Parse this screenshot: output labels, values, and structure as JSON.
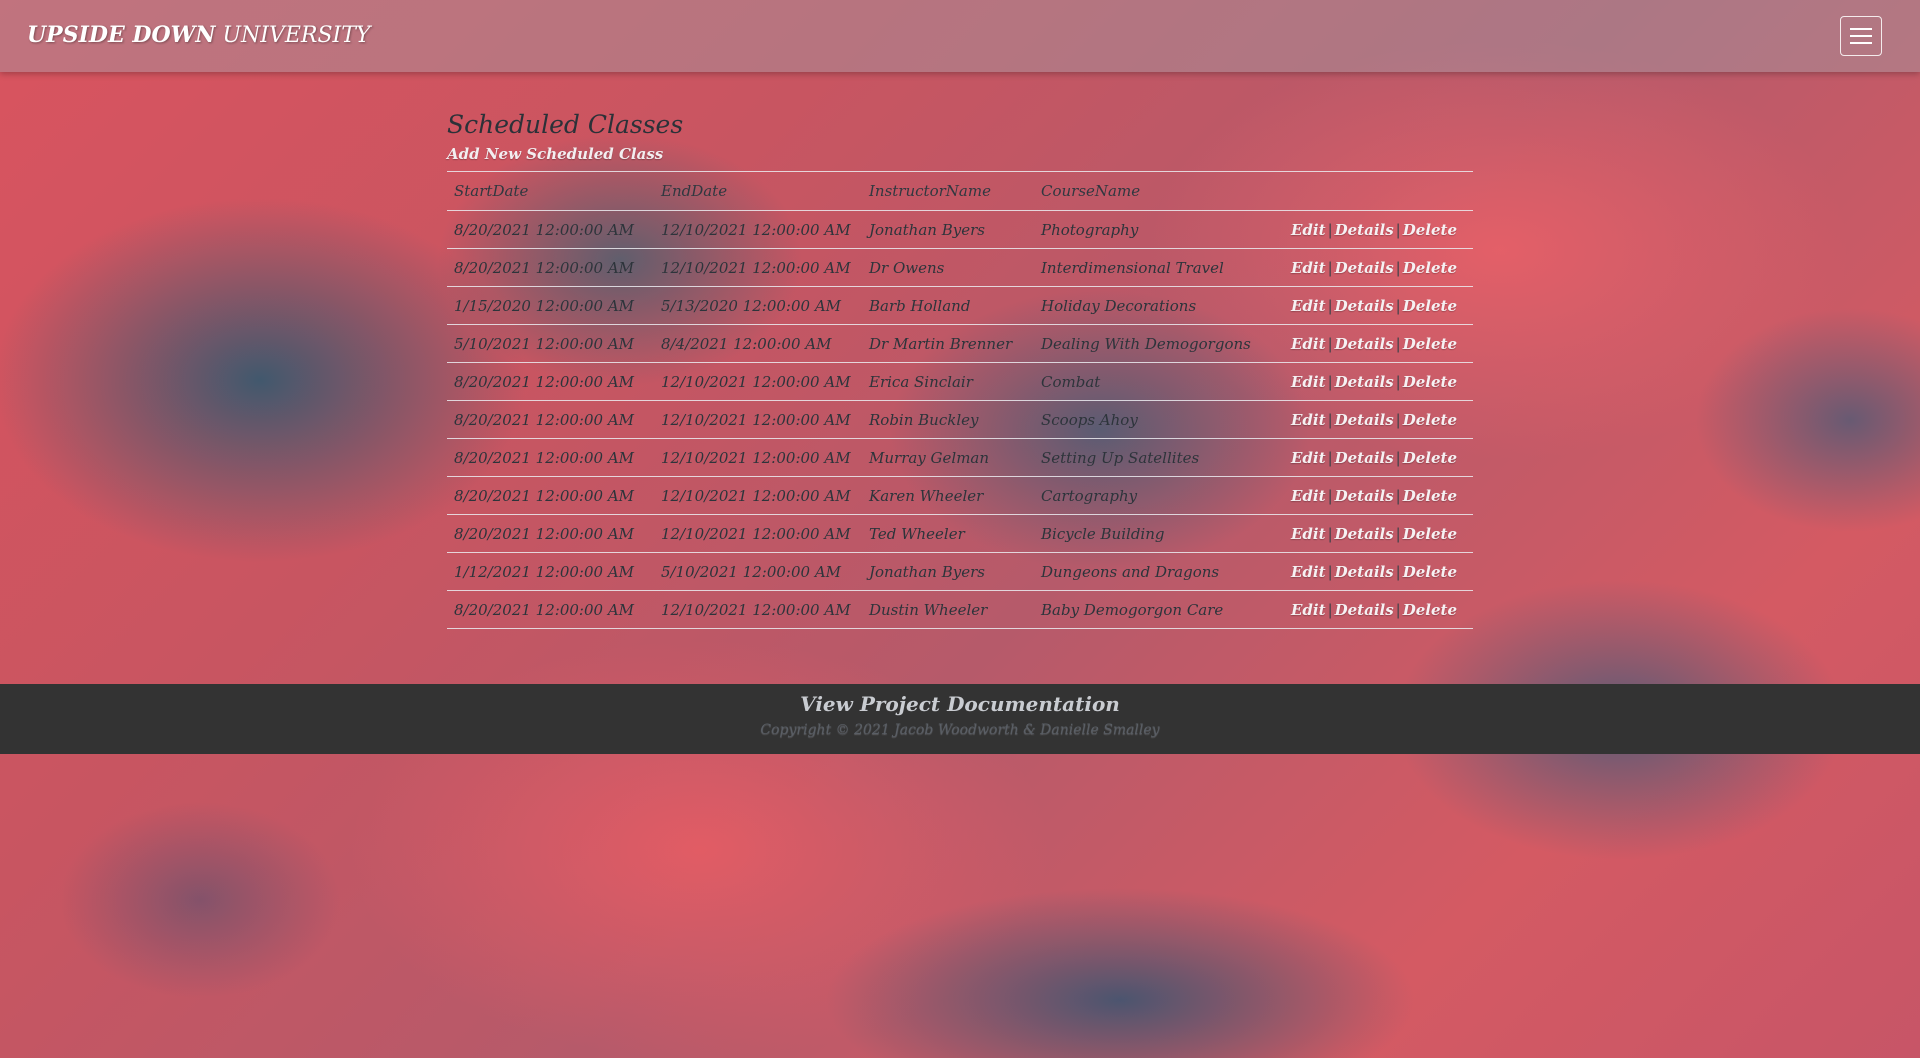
{
  "header": {
    "brand_bold": "UPSIDE DOWN",
    "brand_rest": " UNIVERSITY",
    "menu_icon": "hamburger-menu-icon"
  },
  "main": {
    "title": "Scheduled Classes",
    "add_link": "Add New Scheduled Class",
    "columns": [
      "StartDate",
      "EndDate",
      "InstructorName",
      "CourseName"
    ],
    "rows": [
      {
        "start": "8/20/2021 12:00:00 AM",
        "end": "12/10/2021 12:00:00 AM",
        "instructor": "Jonathan Byers",
        "course": "Photography"
      },
      {
        "start": "8/20/2021 12:00:00 AM",
        "end": "12/10/2021 12:00:00 AM",
        "instructor": "Dr Owens",
        "course": "Interdimensional Travel"
      },
      {
        "start": "1/15/2020 12:00:00 AM",
        "end": "5/13/2020 12:00:00 AM",
        "instructor": "Barb Holland",
        "course": "Holiday Decorations"
      },
      {
        "start": "5/10/2021 12:00:00 AM",
        "end": "8/4/2021 12:00:00 AM",
        "instructor": "Dr Martin Brenner",
        "course": "Dealing With Demogorgons"
      },
      {
        "start": "8/20/2021 12:00:00 AM",
        "end": "12/10/2021 12:00:00 AM",
        "instructor": "Erica Sinclair",
        "course": "Combat"
      },
      {
        "start": "8/20/2021 12:00:00 AM",
        "end": "12/10/2021 12:00:00 AM",
        "instructor": "Robin Buckley",
        "course": "Scoops Ahoy"
      },
      {
        "start": "8/20/2021 12:00:00 AM",
        "end": "12/10/2021 12:00:00 AM",
        "instructor": "Murray Gelman",
        "course": "Setting Up Satellites"
      },
      {
        "start": "8/20/2021 12:00:00 AM",
        "end": "12/10/2021 12:00:00 AM",
        "instructor": "Karen Wheeler",
        "course": "Cartography"
      },
      {
        "start": "8/20/2021 12:00:00 AM",
        "end": "12/10/2021 12:00:00 AM",
        "instructor": "Ted Wheeler",
        "course": "Bicycle Building"
      },
      {
        "start": "1/12/2021 12:00:00 AM",
        "end": "5/10/2021 12:00:00 AM",
        "instructor": "Jonathan Byers",
        "course": "Dungeons and Dragons"
      },
      {
        "start": "8/20/2021 12:00:00 AM",
        "end": "12/10/2021 12:00:00 AM",
        "instructor": "Dustin Wheeler",
        "course": "Baby Demogorgon Care"
      }
    ],
    "actions": {
      "edit": "Edit",
      "details": "Details",
      "delete": "Delete",
      "separator": "|"
    }
  },
  "footer": {
    "doc_link": "View Project Documentation",
    "copyright": "Copyright © 2021 Jacob Woodworth & Danielle Smalley"
  }
}
